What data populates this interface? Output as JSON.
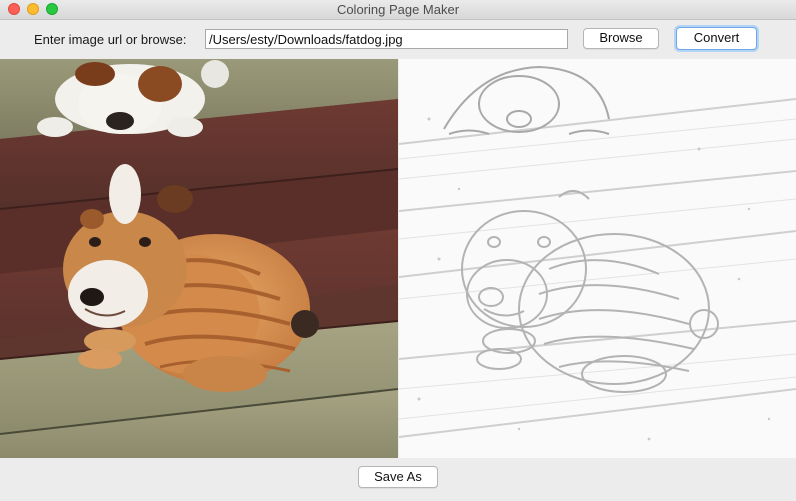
{
  "window": {
    "title": "Coloring Page Maker"
  },
  "toolbar": {
    "url_label": "Enter image url or browse:",
    "url_value": "/Users/esty/Downloads/fatdog.jpg",
    "browse_label": "Browse",
    "convert_label": "Convert"
  },
  "bottom": {
    "save_as_label": "Save As"
  },
  "colors": {
    "close": "#fc5f57",
    "minimize": "#fdbc2e",
    "maximize": "#28c840",
    "focus_ring": "#6fa8e8"
  }
}
